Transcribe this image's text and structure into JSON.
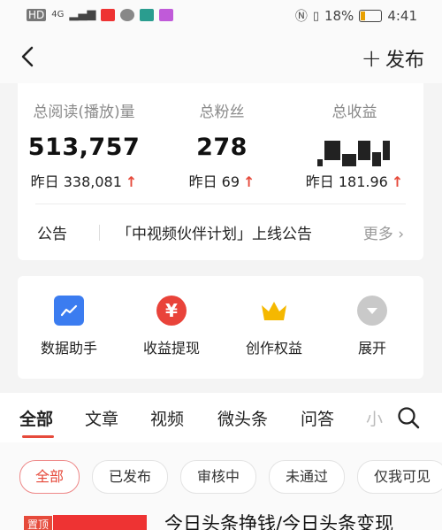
{
  "status_bar": {
    "network": "HD",
    "signal": "4G",
    "battery_percent": "18%",
    "time": "4:41"
  },
  "nav": {
    "publish_label": "发布"
  },
  "stats": {
    "reads": {
      "label": "总阅读(播放)量",
      "value": "513,757",
      "delta": "昨日 338,081"
    },
    "fans": {
      "label": "总粉丝",
      "value": "278",
      "delta": "昨日 69"
    },
    "income": {
      "label": "总收益",
      "delta": "昨日 181.96"
    }
  },
  "notice": {
    "tag": "公告",
    "text": "「中视频伙伴计划」上线公告",
    "more": "更多"
  },
  "tools": [
    {
      "label": "数据助手",
      "icon": "chart-icon",
      "color": "#3b7cf0"
    },
    {
      "label": "收益提现",
      "icon": "yen-icon",
      "color": "#e9433a"
    },
    {
      "label": "创作权益",
      "icon": "crown-icon",
      "color": "#f5b800"
    },
    {
      "label": "展开",
      "icon": "expand-icon",
      "color": "#c9c9c9"
    }
  ],
  "tabs": [
    "全部",
    "文章",
    "视频",
    "微头条",
    "问答",
    "小"
  ],
  "filters": [
    "全部",
    "已发布",
    "审核中",
    "未通过",
    "仅我可见"
  ],
  "article": {
    "pin": "置顶",
    "title": "今日头条挣钱/今日头条变现"
  },
  "colors": {
    "accent": "#e64a3b"
  }
}
